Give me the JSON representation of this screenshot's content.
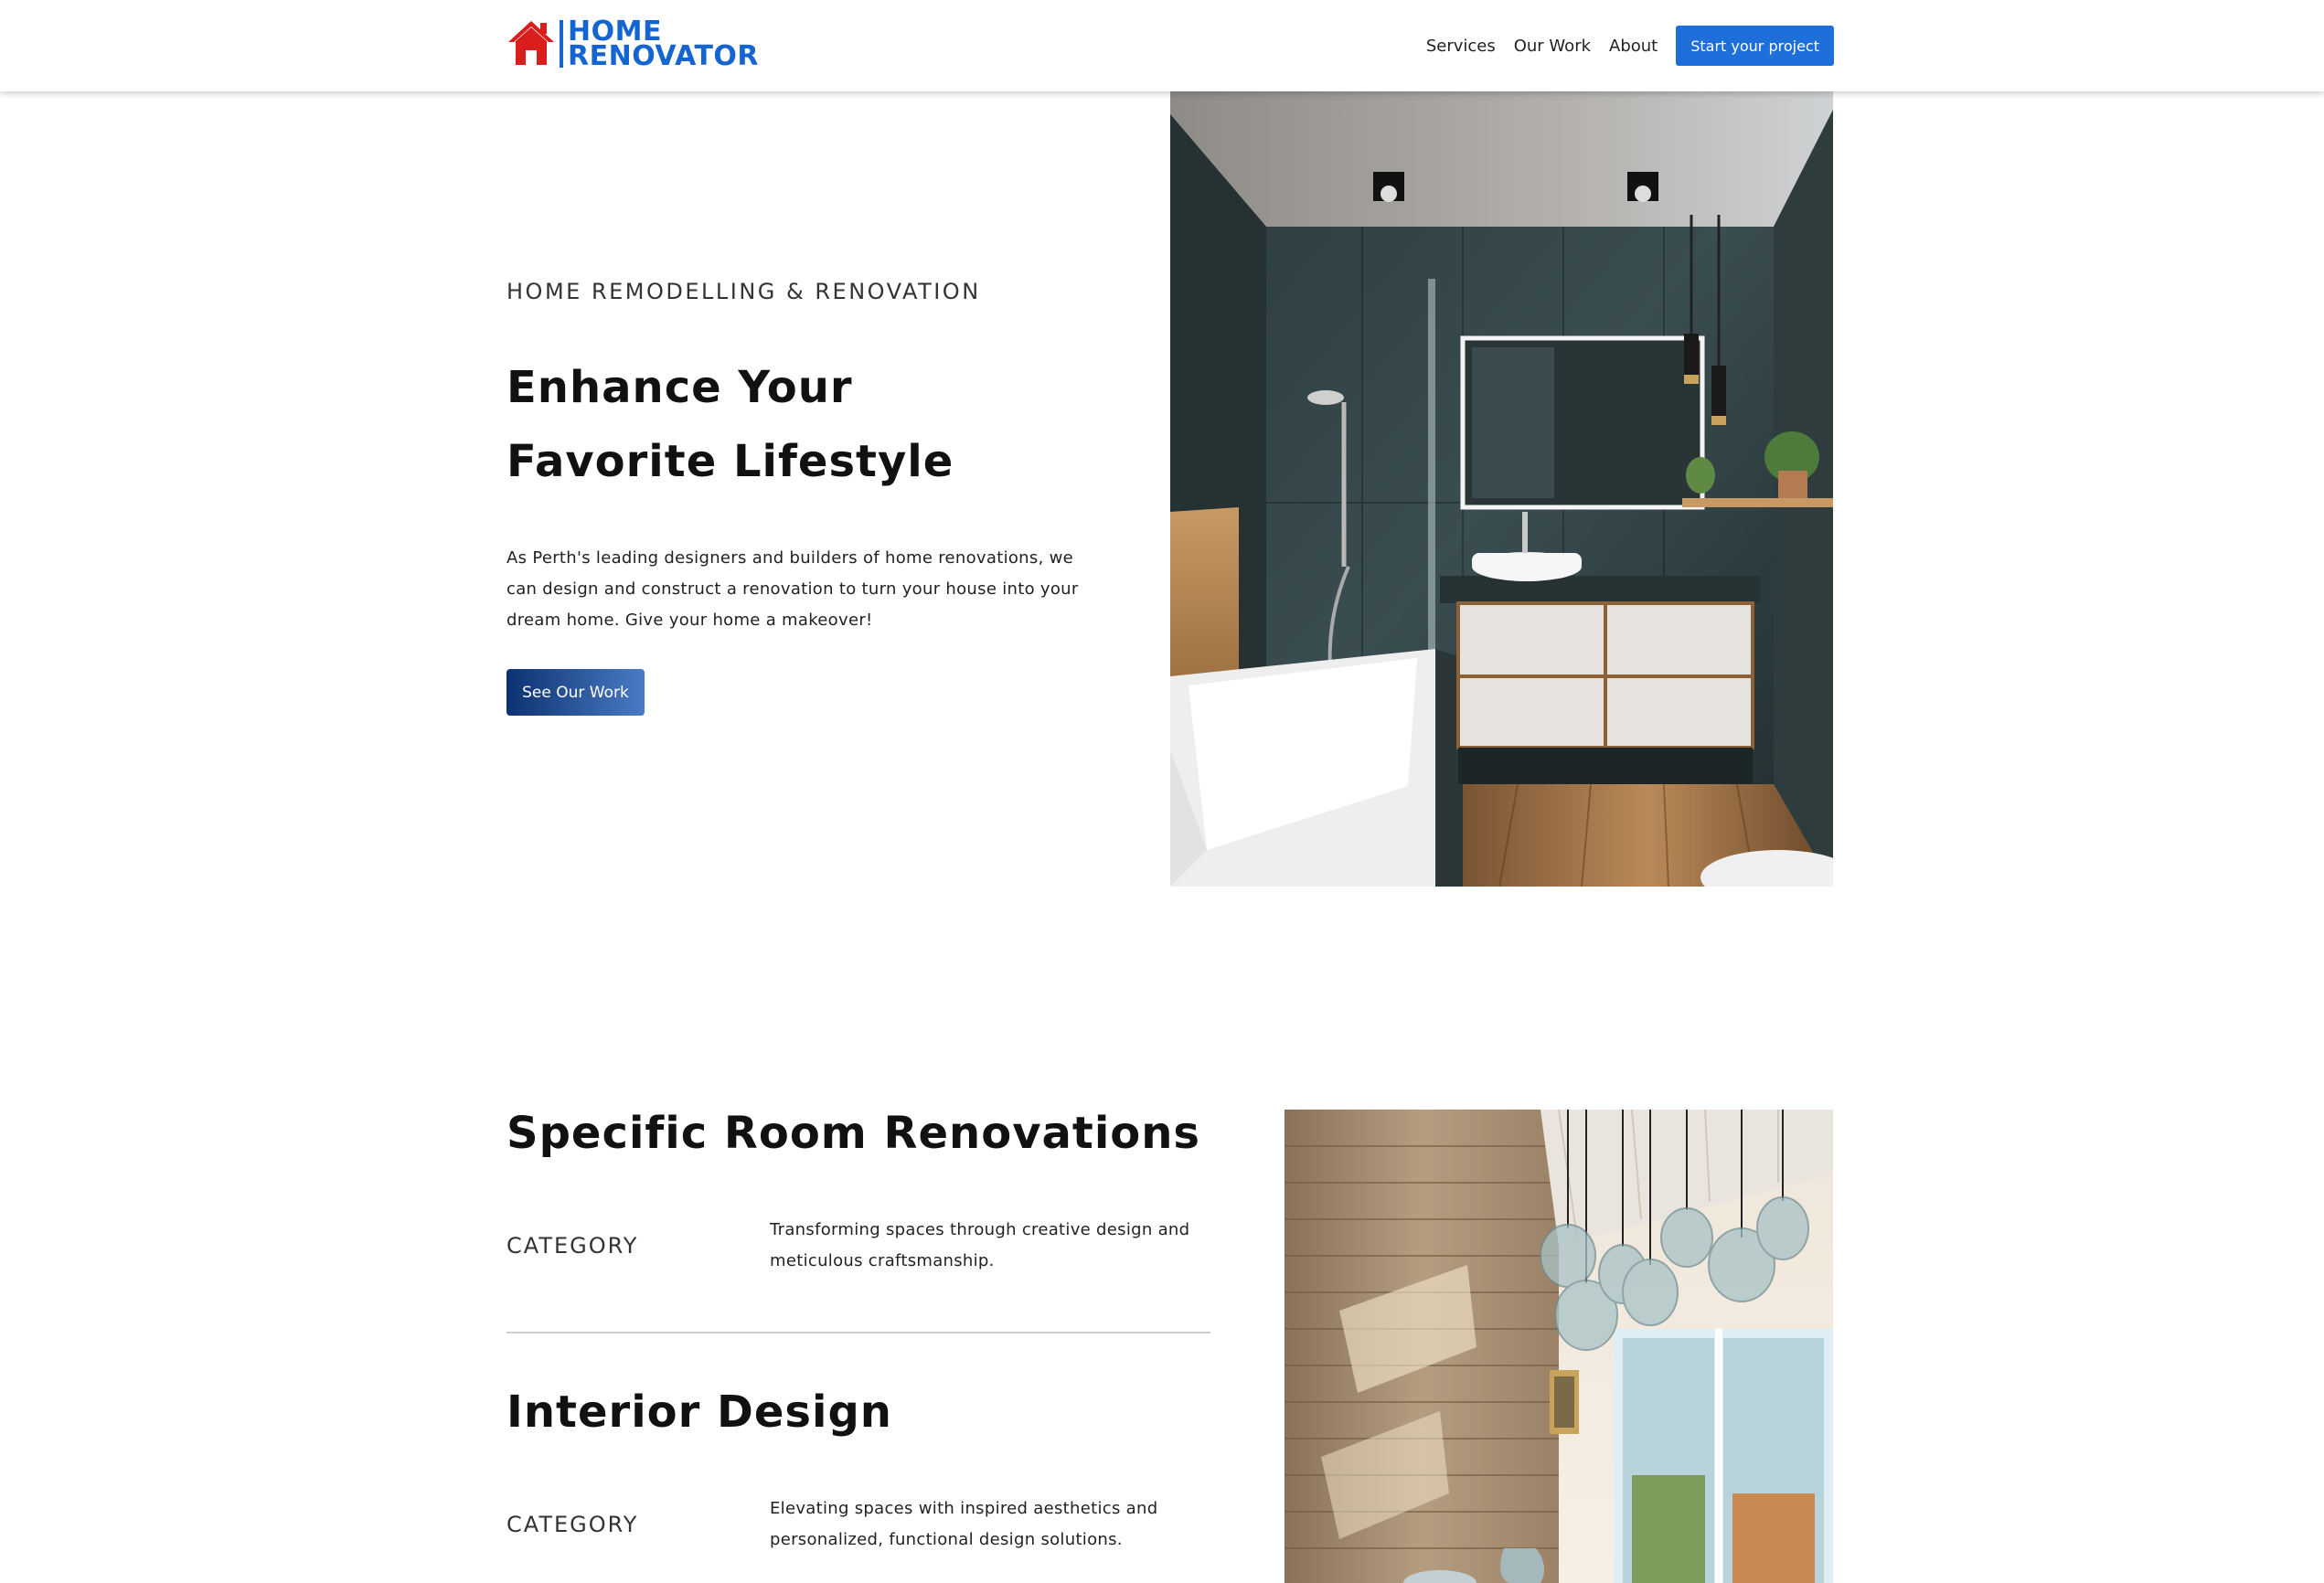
{
  "header": {
    "logo_line1": "HOME",
    "logo_line2": "RENOVATOR",
    "nav": [
      "Services",
      "Our Work",
      "About"
    ],
    "cta_label": "Start your project"
  },
  "hero": {
    "eyebrow": "HOME REMODELLING & RENOVATION",
    "title_line1": "Enhance Your",
    "title_line2": "Favorite Lifestyle",
    "text": "As Perth's leading designers and builders of home renovations, we can design and construct a renovation to turn your house into your dream home. Give your home a makeover!",
    "button_label": "See Our Work"
  },
  "services": [
    {
      "title": "Specific Room Renovations",
      "category_label": "CATEGORY",
      "description": "Transforming spaces through creative design and meticulous craftsmanship."
    },
    {
      "title": "Interior Design",
      "category_label": "CATEGORY",
      "description": "Elevating spaces with inspired aesthetics and personalized, functional design solutions."
    }
  ],
  "colors": {
    "brand_blue": "#1565d0",
    "logo_red": "#d91e1e",
    "cta_blue": "#1e6fd9",
    "button_gradient_start": "#0c3270",
    "button_gradient_end": "#4a7bc4"
  },
  "icons": {
    "logo": "house-icon"
  }
}
